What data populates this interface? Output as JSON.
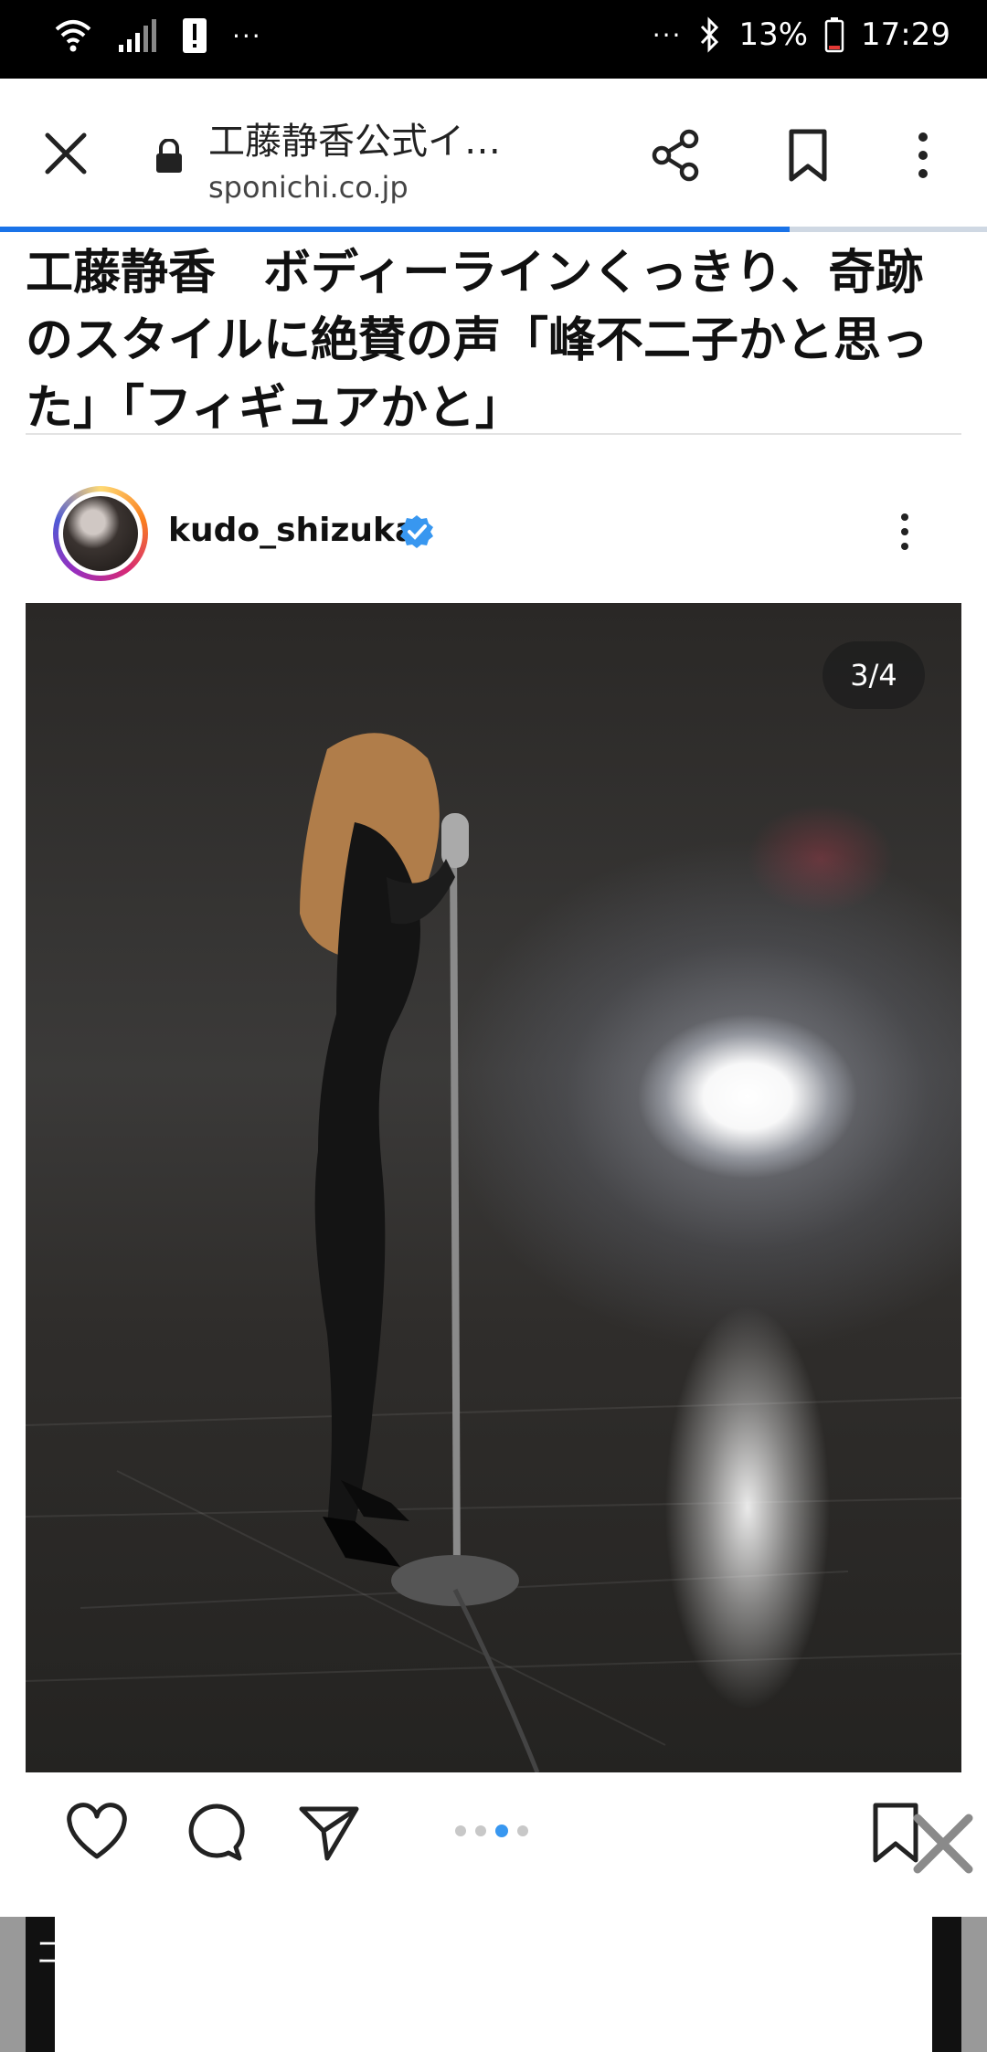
{
  "status_bar": {
    "left_dots": "···",
    "right_dots": "···",
    "battery_percent": "13%",
    "time": "17:29"
  },
  "browser": {
    "page_title": "工藤静香公式イ…",
    "domain": "sponichi.co.jp",
    "load_progress": 0.8
  },
  "article": {
    "headline": "工藤静香　ボディーラインくっきり、奇跡のスタイルに絶賛の声「峰不二子かと思った」「フィギュアかと」"
  },
  "instagram": {
    "username": "kudo_shizuka",
    "verified": true,
    "image_counter": "3/4",
    "carousel": {
      "count": 4,
      "active_index": 2
    }
  },
  "ad": {
    "edge_text": "コ"
  },
  "icons": {
    "close": "close-icon",
    "lock": "lock-icon",
    "share": "share-icon",
    "bookmark": "bookmark-icon",
    "more": "more-vert-icon",
    "like": "heart-icon",
    "comment": "comment-icon",
    "send": "send-icon",
    "save": "bookmark-icon",
    "ad_close": "close-icon"
  },
  "colors": {
    "accent": "#1a73e8",
    "verified": "#3897f0",
    "carousel_active": "#3897f0"
  }
}
